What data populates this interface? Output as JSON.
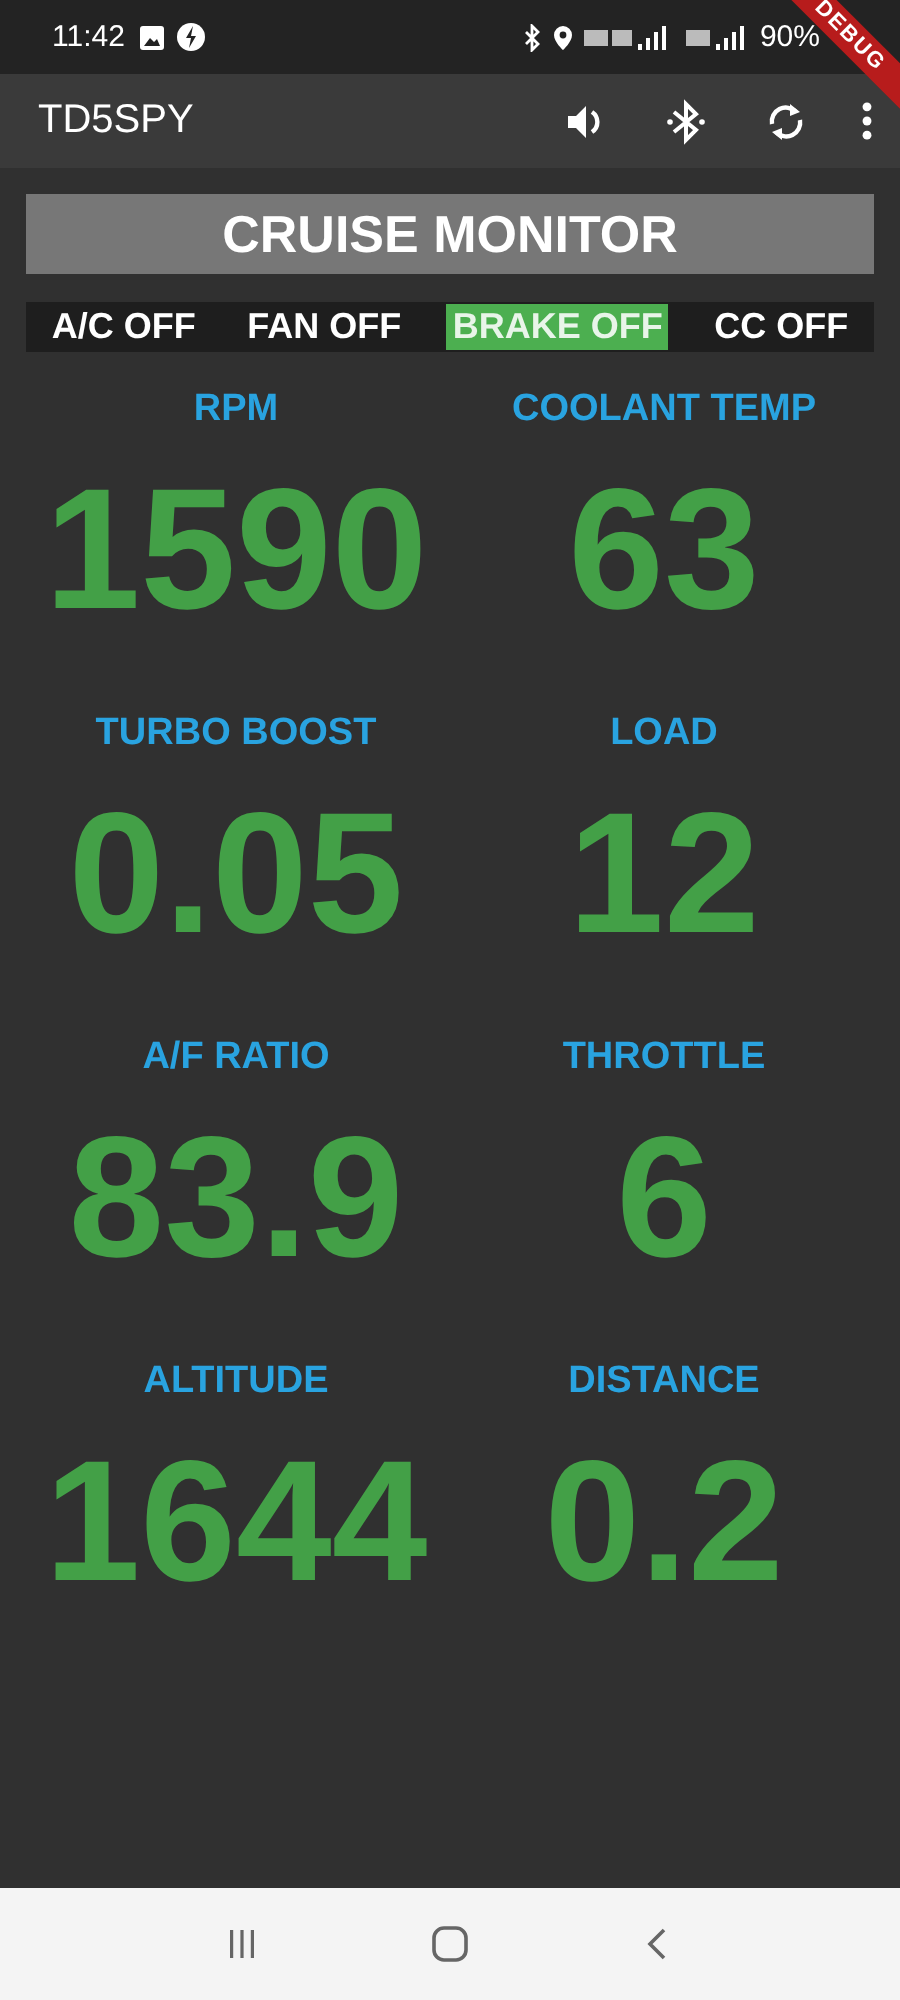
{
  "status_bar": {
    "time": "11:42",
    "battery": "90%"
  },
  "debug_banner": "DEBUG",
  "app_bar": {
    "title": "TD5SPY"
  },
  "panel": {
    "title": "CRUISE MONITOR"
  },
  "indicators": [
    {
      "label": "A/C OFF",
      "on": false
    },
    {
      "label": "FAN OFF",
      "on": false
    },
    {
      "label": "BRAKE OFF",
      "on": true
    },
    {
      "label": "CC OFF",
      "on": false
    }
  ],
  "gauges": [
    {
      "label": "RPM",
      "value": "1590"
    },
    {
      "label": "COOLANT TEMP",
      "value": "63"
    },
    {
      "label": "TURBO BOOST",
      "value": "0.05"
    },
    {
      "label": "LOAD",
      "value": "12"
    },
    {
      "label": "A/F RATIO",
      "value": "83.9"
    },
    {
      "label": "THROTTLE",
      "value": "6"
    },
    {
      "label": "ALTITUDE",
      "value": "1644"
    },
    {
      "label": "DISTANCE",
      "value": "0.2"
    }
  ]
}
